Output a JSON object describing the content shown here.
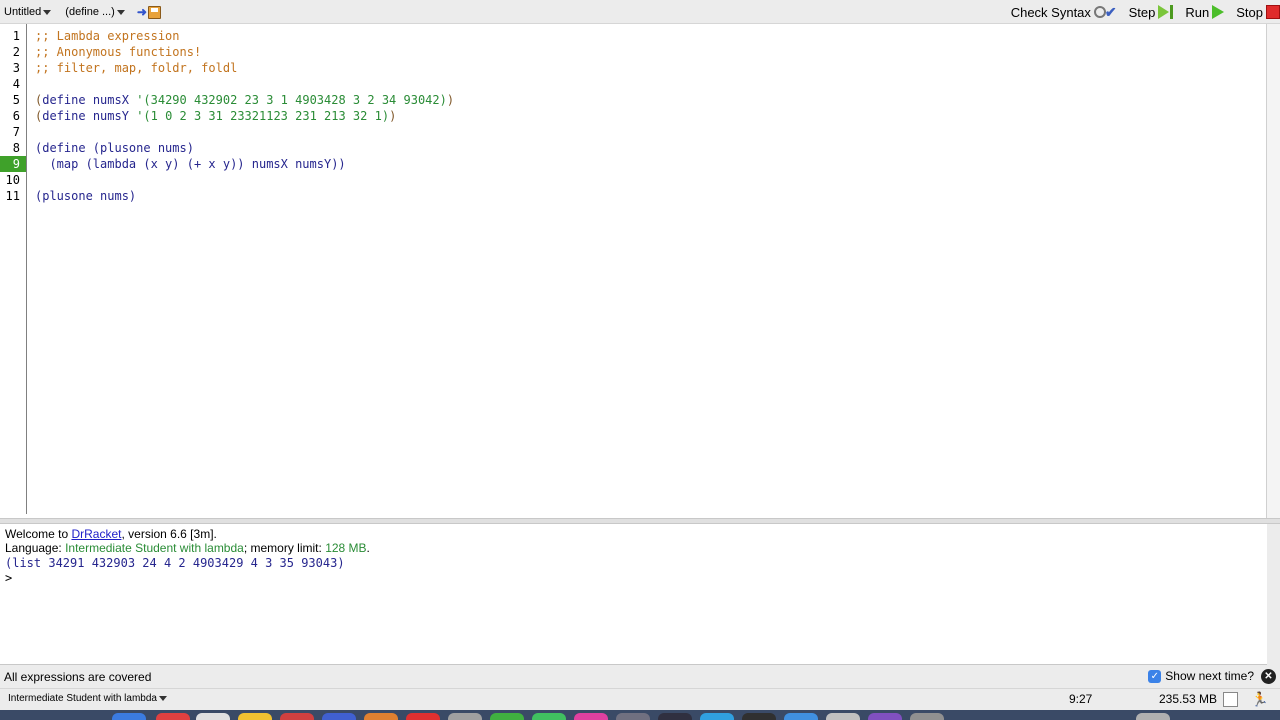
{
  "toolbar": {
    "file_menu": "Untitled",
    "define_menu": "(define ...)",
    "check_syntax": "Check Syntax",
    "step": "Step",
    "run": "Run",
    "stop": "Stop"
  },
  "editor": {
    "line_numbers": [
      "1",
      "2",
      "3",
      "4",
      "5",
      "6",
      "7",
      "8",
      "9",
      "10",
      "11"
    ],
    "current_line": "9",
    "lines": {
      "l1": ";; Lambda expression",
      "l2": ";; Anonymous functions!",
      "l3": ";; filter, map, foldr, foldl",
      "l5_open": "(",
      "l5_define": "define",
      "l5_name": "numsX",
      "l5_quote": "'(34290 432902 23 3 1 4903428 3 2 34 93042)",
      "l5_close": ")",
      "l6_open": "(",
      "l6_define": "define",
      "l6_name": "numsY",
      "l6_quote": "'(1 0 2 3 31 23321123 231 213 32 1)",
      "l6_close": ")",
      "l8": "(define (plusone nums)",
      "l9": "  (map (lambda (x y) (+ x y)) numsX numsY))",
      "l11": "(plusone nums)"
    }
  },
  "interactions": {
    "welcome_prefix": "Welcome to ",
    "welcome_link": "DrRacket",
    "welcome_suffix": ", version 6.6 [3m].",
    "language_prefix": "Language: ",
    "language_name": "Intermediate Student with lambda",
    "language_mid": "; memory limit: ",
    "memory_limit": "128 MB",
    "language_end": ".",
    "result": "(list 34291 432903 24 4 2 4903429 4 3 35 93043)",
    "prompt": ">"
  },
  "coverage": {
    "message": "All expressions are covered",
    "show_next_label": "Show next time?",
    "show_next_checked": true
  },
  "status": {
    "language": "Intermediate Student with lambda",
    "position": "9:27",
    "memory": "235.53 MB"
  },
  "colors": {
    "comment": "#c2741f",
    "paren": "#80582a",
    "identifier": "#26268e",
    "constant": "#2a8c36",
    "current_line": "#3fa12a",
    "stop": "#e02b2b"
  }
}
